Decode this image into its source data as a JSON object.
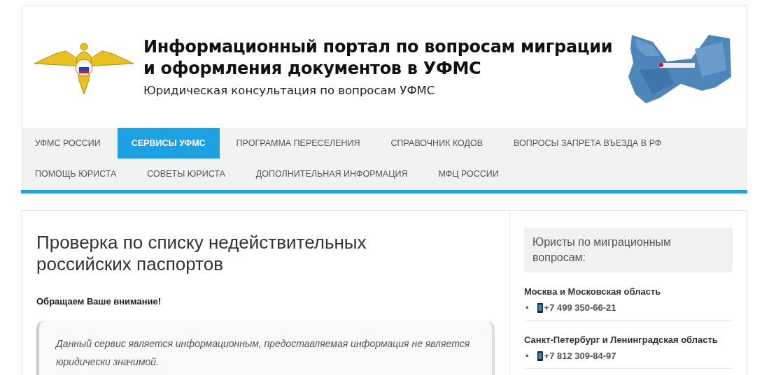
{
  "header": {
    "title_lines": [
      "Информационный портал по вопросам миграции",
      "и оформления документов в УФМС"
    ],
    "subtitle": "Юридическая консультация по вопросам УФМС"
  },
  "nav": {
    "rows": [
      [
        {
          "label": "УФМС РОССИИ",
          "selected": false
        },
        {
          "label": "СЕРВИСЫ УФМС",
          "selected": true
        },
        {
          "label": "ПРОГРАММА ПЕРЕСЕЛЕНИЯ",
          "selected": false
        },
        {
          "label": "СПРАВОЧНИК КОДОВ",
          "selected": false
        },
        {
          "label": "ВОПРОСЫ ЗАПРЕТА ВЪЕЗДА В РФ",
          "selected": false
        }
      ],
      [
        {
          "label": "ПОМОЩЬ ЮРИСТА",
          "selected": false
        },
        {
          "label": "СОВЕТЫ ЮРИСТА",
          "selected": false
        },
        {
          "label": "ДОПОЛНИТЕЛЬНАЯ ИНФОРМАЦИЯ",
          "selected": false
        },
        {
          "label": "МФЦ РОССИИ",
          "selected": false
        }
      ]
    ]
  },
  "article": {
    "title": "Проверка по списку недействительных российских паспортов",
    "notice": "Обращаем Ваше внимание!",
    "quote": "Данный сервис является информационным, предоставляемая информация не является юридически значимой."
  },
  "sidebar": {
    "heading": "Юристы по миграционным вопросам:",
    "regions": [
      {
        "name": "Москва и Московская область",
        "phones": [
          {
            "bullet": "•",
            "number": "+7 499 350-66-21"
          }
        ]
      },
      {
        "name": "Санкт-Петербург и Ленинградская область",
        "phones": [
          {
            "bullet": "•",
            "number": "+7 812 309-84-97"
          }
        ]
      }
    ]
  }
}
